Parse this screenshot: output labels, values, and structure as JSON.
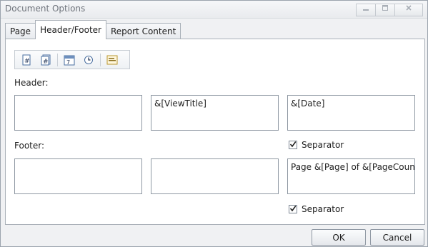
{
  "window": {
    "title": "Document Options"
  },
  "titlebar_buttons": [
    {
      "icon": "minimize-icon"
    },
    {
      "icon": "maximize-icon"
    },
    {
      "icon": "close-icon"
    }
  ],
  "tabs": [
    {
      "label": "Page",
      "active": false
    },
    {
      "label": "Header/Footer",
      "active": true
    },
    {
      "label": "Report Content",
      "active": false
    }
  ],
  "toolbar": {
    "items": [
      {
        "icon": "page-number-icon"
      },
      {
        "icon": "page-count-icon"
      },
      {
        "icon": "date-icon"
      },
      {
        "icon": "time-icon"
      },
      {
        "icon": "view-title-icon"
      }
    ]
  },
  "header": {
    "label": "Header:",
    "left": "",
    "center": "&[ViewTitle]",
    "right": "&[Date]",
    "separator": {
      "label": "Separator",
      "checked": true
    }
  },
  "footer": {
    "label": "Footer:",
    "left": "",
    "center": "",
    "right": "Page &[Page] of &[PageCount]",
    "separator": {
      "label": "Separator",
      "checked": true
    }
  },
  "buttons": {
    "ok": "OK",
    "cancel": "Cancel"
  }
}
